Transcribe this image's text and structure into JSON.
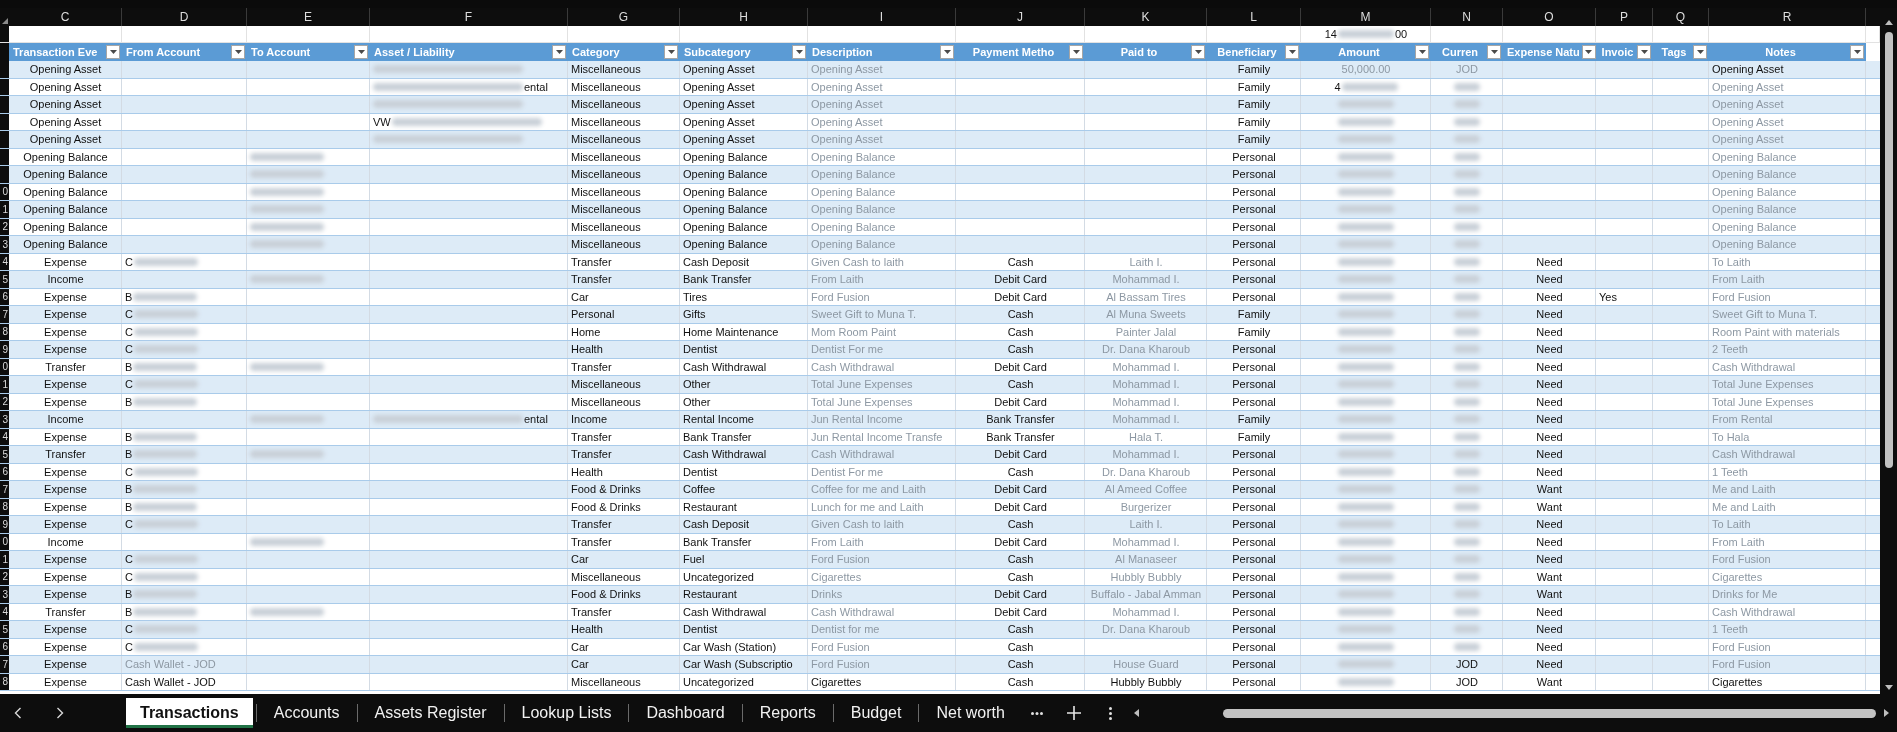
{
  "columns": [
    {
      "letter": "C",
      "header": "Transaction Eve"
    },
    {
      "letter": "D",
      "header": "From Account"
    },
    {
      "letter": "E",
      "header": "To Account"
    },
    {
      "letter": "F",
      "header": "Asset / Liability"
    },
    {
      "letter": "G",
      "header": "Category"
    },
    {
      "letter": "H",
      "header": "Subcategory"
    },
    {
      "letter": "I",
      "header": "Description"
    },
    {
      "letter": "J",
      "header": "Payment Metho"
    },
    {
      "letter": "K",
      "header": "Paid to"
    },
    {
      "letter": "L",
      "header": "Beneficiary"
    },
    {
      "letter": "M",
      "header": "Amount"
    },
    {
      "letter": "N",
      "header": "Curren"
    },
    {
      "letter": "O",
      "header": "Expense Natu"
    },
    {
      "letter": "P",
      "header": "Invoic"
    },
    {
      "letter": "Q",
      "header": "Tags"
    },
    {
      "letter": "R",
      "header": "Notes"
    }
  ],
  "summary_row": {
    "cells": [
      null,
      null,
      null,
      null,
      null,
      null,
      null,
      null,
      null,
      null,
      {
        "kind": "redacted",
        "text": "14",
        "suffix": "00"
      },
      null,
      null,
      null,
      null,
      null
    ]
  },
  "rows": [
    {
      "cells": [
        "Opening Asset",
        null,
        null,
        {
          "kind": "redacted"
        },
        "Miscellaneous",
        "Opening Asset",
        {
          "kind": "faded",
          "text": "Opening Asset"
        },
        null,
        null,
        "Family",
        {
          "kind": "faded",
          "text": "50,000.00"
        },
        {
          "kind": "faded",
          "text": "JOD"
        },
        null,
        null,
        null,
        "Opening Asset"
      ]
    },
    {
      "cells": [
        "Opening Asset",
        null,
        null,
        {
          "kind": "redacted",
          "suffix": "ental"
        },
        "Miscellaneous",
        "Opening Asset",
        {
          "kind": "faded",
          "text": "Opening Asset"
        },
        null,
        null,
        "Family",
        {
          "kind": "redacted",
          "text": "4"
        },
        {
          "kind": "redacted"
        },
        null,
        null,
        null,
        {
          "kind": "faded",
          "text": "Opening Asset"
        }
      ]
    },
    {
      "cells": [
        "Opening Asset",
        null,
        null,
        {
          "kind": "redacted"
        },
        "Miscellaneous",
        "Opening Asset",
        {
          "kind": "faded",
          "text": "Opening Asset"
        },
        null,
        null,
        "Family",
        {
          "kind": "redacted"
        },
        {
          "kind": "redacted"
        },
        null,
        null,
        null,
        {
          "kind": "faded",
          "text": "Opening Asset"
        }
      ]
    },
    {
      "cells": [
        "Opening Asset",
        null,
        null,
        {
          "kind": "redacted",
          "text": "VW"
        },
        "Miscellaneous",
        "Opening Asset",
        {
          "kind": "faded",
          "text": "Opening Asset"
        },
        null,
        null,
        "Family",
        {
          "kind": "redacted"
        },
        {
          "kind": "redacted"
        },
        null,
        null,
        null,
        {
          "kind": "faded",
          "text": "Opening Asset"
        }
      ]
    },
    {
      "cells": [
        "Opening Asset",
        null,
        null,
        {
          "kind": "redacted"
        },
        "Miscellaneous",
        "Opening Asset",
        {
          "kind": "faded",
          "text": "Opening Asset"
        },
        null,
        null,
        "Family",
        {
          "kind": "redacted"
        },
        {
          "kind": "redacted"
        },
        null,
        null,
        null,
        {
          "kind": "faded",
          "text": "Opening Asset"
        }
      ]
    },
    {
      "cells": [
        "Opening Balance",
        null,
        {
          "kind": "redacted"
        },
        null,
        "Miscellaneous",
        "Opening Balance",
        {
          "kind": "faded",
          "text": "Opening Balance"
        },
        null,
        null,
        "Personal",
        {
          "kind": "redacted"
        },
        {
          "kind": "redacted"
        },
        null,
        null,
        null,
        {
          "kind": "faded",
          "text": "Opening Balance"
        }
      ]
    },
    {
      "cells": [
        "Opening Balance",
        null,
        {
          "kind": "redacted"
        },
        null,
        "Miscellaneous",
        "Opening Balance",
        {
          "kind": "faded",
          "text": "Opening Balance"
        },
        null,
        null,
        "Personal",
        {
          "kind": "redacted"
        },
        {
          "kind": "redacted"
        },
        null,
        null,
        null,
        {
          "kind": "faded",
          "text": "Opening Balance"
        }
      ]
    },
    {
      "row_label": "0",
      "cells": [
        "Opening Balance",
        null,
        {
          "kind": "redacted"
        },
        null,
        "Miscellaneous",
        "Opening Balance",
        {
          "kind": "faded",
          "text": "Opening Balance"
        },
        null,
        null,
        "Personal",
        {
          "kind": "redacted"
        },
        {
          "kind": "redacted"
        },
        null,
        null,
        null,
        {
          "kind": "faded",
          "text": "Opening Balance"
        }
      ]
    },
    {
      "row_label": "1",
      "cells": [
        "Opening Balance",
        null,
        {
          "kind": "redacted"
        },
        null,
        "Miscellaneous",
        "Opening Balance",
        {
          "kind": "faded",
          "text": "Opening Balance"
        },
        null,
        null,
        "Personal",
        {
          "kind": "redacted"
        },
        {
          "kind": "redacted"
        },
        null,
        null,
        null,
        {
          "kind": "faded",
          "text": "Opening Balance"
        }
      ]
    },
    {
      "row_label": "2",
      "cells": [
        "Opening Balance",
        null,
        {
          "kind": "redacted"
        },
        null,
        "Miscellaneous",
        "Opening Balance",
        {
          "kind": "faded",
          "text": "Opening Balance"
        },
        null,
        null,
        "Personal",
        {
          "kind": "redacted"
        },
        {
          "kind": "redacted"
        },
        null,
        null,
        null,
        {
          "kind": "faded",
          "text": "Opening Balance"
        }
      ]
    },
    {
      "row_label": "3",
      "cells": [
        "Opening Balance",
        null,
        {
          "kind": "redacted"
        },
        null,
        "Miscellaneous",
        "Opening Balance",
        {
          "kind": "faded",
          "text": "Opening Balance"
        },
        null,
        null,
        "Personal",
        {
          "kind": "redacted"
        },
        {
          "kind": "redacted"
        },
        null,
        null,
        null,
        {
          "kind": "faded",
          "text": "Opening Balance"
        }
      ]
    },
    {
      "row_label": "4",
      "cells": [
        "Expense",
        {
          "kind": "redacted",
          "text": "C"
        },
        null,
        null,
        "Transfer",
        "Cash Deposit",
        {
          "kind": "faded",
          "text": "Given Cash to laith"
        },
        "Cash",
        {
          "kind": "faded",
          "text": "Laith I."
        },
        "Personal",
        {
          "kind": "redacted"
        },
        {
          "kind": "redacted"
        },
        "Need",
        null,
        null,
        {
          "kind": "faded",
          "text": "To Laith"
        }
      ]
    },
    {
      "row_label": "5",
      "cells": [
        "Income",
        null,
        {
          "kind": "redacted"
        },
        null,
        "Transfer",
        "Bank Transfer",
        {
          "kind": "faded",
          "text": "From Laith"
        },
        "Debit Card",
        {
          "kind": "faded",
          "text": "Mohammad I."
        },
        "Personal",
        {
          "kind": "redacted"
        },
        {
          "kind": "redacted"
        },
        "Need",
        null,
        null,
        {
          "kind": "faded",
          "text": "From Laith"
        }
      ]
    },
    {
      "row_label": "6",
      "cells": [
        "Expense",
        {
          "kind": "redacted",
          "text": "B"
        },
        null,
        null,
        "Car",
        "Tires",
        {
          "kind": "faded",
          "text": "Ford Fusion"
        },
        "Debit Card",
        {
          "kind": "faded",
          "text": "Al Bassam Tires"
        },
        "Personal",
        {
          "kind": "redacted"
        },
        {
          "kind": "redacted"
        },
        "Need",
        "Yes",
        null,
        {
          "kind": "faded",
          "text": "Ford Fusion"
        }
      ]
    },
    {
      "row_label": "7",
      "cells": [
        "Expense",
        {
          "kind": "redacted",
          "text": "C"
        },
        null,
        null,
        "Personal",
        "Gifts",
        {
          "kind": "faded",
          "text": "Sweet Gift to Muna T."
        },
        "Cash",
        {
          "kind": "faded",
          "text": "Al Muna Sweets"
        },
        "Family",
        {
          "kind": "redacted"
        },
        {
          "kind": "redacted"
        },
        "Need",
        null,
        null,
        {
          "kind": "faded",
          "text": "Sweet Gift to Muna T."
        }
      ]
    },
    {
      "row_label": "8",
      "cells": [
        "Expense",
        {
          "kind": "redacted",
          "text": "C"
        },
        null,
        null,
        "Home",
        "Home Maintenance",
        {
          "kind": "faded",
          "text": "Mom Room Paint"
        },
        "Cash",
        {
          "kind": "faded",
          "text": "Painter Jalal"
        },
        "Family",
        {
          "kind": "redacted"
        },
        {
          "kind": "redacted"
        },
        "Need",
        null,
        null,
        {
          "kind": "faded",
          "text": "Room Paint with materials"
        }
      ]
    },
    {
      "row_label": "9",
      "cells": [
        "Expense",
        {
          "kind": "redacted",
          "text": "C"
        },
        null,
        null,
        "Health",
        "Dentist",
        {
          "kind": "faded",
          "text": "Dentist For me"
        },
        "Cash",
        {
          "kind": "faded",
          "text": "Dr. Dana Kharoub"
        },
        "Personal",
        {
          "kind": "redacted"
        },
        {
          "kind": "redacted"
        },
        "Need",
        null,
        null,
        {
          "kind": "faded",
          "text": "2 Teeth"
        }
      ]
    },
    {
      "row_label": "0",
      "cells": [
        "Transfer",
        {
          "kind": "redacted",
          "text": "B"
        },
        {
          "kind": "redacted"
        },
        null,
        "Transfer",
        "Cash Withdrawal",
        {
          "kind": "faded",
          "text": "Cash Withdrawal"
        },
        "Debit Card",
        {
          "kind": "faded",
          "text": "Mohammad I."
        },
        "Personal",
        {
          "kind": "redacted"
        },
        {
          "kind": "redacted"
        },
        "Need",
        null,
        null,
        {
          "kind": "faded",
          "text": "Cash Withdrawal"
        }
      ]
    },
    {
      "row_label": "1",
      "cells": [
        "Expense",
        {
          "kind": "redacted",
          "text": "C"
        },
        null,
        null,
        "Miscellaneous",
        "Other",
        {
          "kind": "faded",
          "text": "Total June Expenses"
        },
        "Cash",
        {
          "kind": "faded",
          "text": "Mohammad I."
        },
        "Personal",
        {
          "kind": "redacted"
        },
        {
          "kind": "redacted"
        },
        "Need",
        null,
        null,
        {
          "kind": "faded",
          "text": "Total June Expenses"
        }
      ]
    },
    {
      "row_label": "2",
      "cells": [
        "Expense",
        {
          "kind": "redacted",
          "text": "B"
        },
        null,
        null,
        "Miscellaneous",
        "Other",
        {
          "kind": "faded",
          "text": "Total June Expenses"
        },
        "Debit Card",
        {
          "kind": "faded",
          "text": "Mohammad I."
        },
        "Personal",
        {
          "kind": "redacted"
        },
        {
          "kind": "redacted"
        },
        "Need",
        null,
        null,
        {
          "kind": "faded",
          "text": "Total June Expenses"
        }
      ]
    },
    {
      "row_label": "3",
      "cells": [
        "Income",
        null,
        {
          "kind": "redacted"
        },
        {
          "kind": "redacted",
          "suffix": "ental"
        },
        "Income",
        "Rental Income",
        {
          "kind": "faded",
          "text": "Jun Rental Income"
        },
        "Bank Transfer",
        {
          "kind": "faded",
          "text": "Mohammad I."
        },
        "Family",
        {
          "kind": "redacted"
        },
        {
          "kind": "redacted"
        },
        "Need",
        null,
        null,
        {
          "kind": "faded",
          "text": "From Rental"
        }
      ]
    },
    {
      "row_label": "4",
      "cells": [
        "Expense",
        {
          "kind": "redacted",
          "text": "B"
        },
        null,
        null,
        "Transfer",
        "Bank Transfer",
        {
          "kind": "faded",
          "text": "Jun Rental Income Transfe"
        },
        "Bank Transfer",
        {
          "kind": "faded",
          "text": "Hala T."
        },
        "Family",
        {
          "kind": "redacted"
        },
        {
          "kind": "redacted"
        },
        "Need",
        null,
        null,
        {
          "kind": "faded",
          "text": "To Hala"
        }
      ]
    },
    {
      "row_label": "5",
      "cells": [
        "Transfer",
        {
          "kind": "redacted",
          "text": "B"
        },
        {
          "kind": "redacted"
        },
        null,
        "Transfer",
        "Cash Withdrawal",
        {
          "kind": "faded",
          "text": "Cash Withdrawal"
        },
        "Debit Card",
        {
          "kind": "faded",
          "text": "Mohammad I."
        },
        "Personal",
        {
          "kind": "redacted"
        },
        {
          "kind": "redacted"
        },
        "Need",
        null,
        null,
        {
          "kind": "faded",
          "text": "Cash Withdrawal"
        }
      ]
    },
    {
      "row_label": "6",
      "cells": [
        "Expense",
        {
          "kind": "redacted",
          "text": "C"
        },
        null,
        null,
        "Health",
        "Dentist",
        {
          "kind": "faded",
          "text": "Dentist For me"
        },
        "Cash",
        {
          "kind": "faded",
          "text": "Dr. Dana Kharoub"
        },
        "Personal",
        {
          "kind": "redacted"
        },
        {
          "kind": "redacted"
        },
        "Need",
        null,
        null,
        {
          "kind": "faded",
          "text": "1 Teeth"
        }
      ]
    },
    {
      "row_label": "7",
      "cells": [
        "Expense",
        {
          "kind": "redacted",
          "text": "B"
        },
        null,
        null,
        "Food & Drinks",
        "Coffee",
        {
          "kind": "faded",
          "text": "Coffee for me and Laith"
        },
        "Debit Card",
        {
          "kind": "faded",
          "text": "Al Ameed Coffee"
        },
        "Personal",
        {
          "kind": "redacted"
        },
        {
          "kind": "redacted"
        },
        "Want",
        null,
        null,
        {
          "kind": "faded",
          "text": "Me and Laith"
        }
      ]
    },
    {
      "row_label": "8",
      "cells": [
        "Expense",
        {
          "kind": "redacted",
          "text": "B"
        },
        null,
        null,
        "Food & Drinks",
        "Restaurant",
        {
          "kind": "faded",
          "text": "Lunch for me and Laith"
        },
        "Debit Card",
        {
          "kind": "faded",
          "text": "Burgerizer"
        },
        "Personal",
        {
          "kind": "redacted"
        },
        {
          "kind": "redacted"
        },
        "Want",
        null,
        null,
        {
          "kind": "faded",
          "text": "Me and Laith"
        }
      ]
    },
    {
      "row_label": "9",
      "cells": [
        "Expense",
        {
          "kind": "redacted",
          "text": "C"
        },
        null,
        null,
        "Transfer",
        "Cash Deposit",
        {
          "kind": "faded",
          "text": "Given Cash to laith"
        },
        "Cash",
        {
          "kind": "faded",
          "text": "Laith I."
        },
        "Personal",
        {
          "kind": "redacted"
        },
        {
          "kind": "redacted"
        },
        "Need",
        null,
        null,
        {
          "kind": "faded",
          "text": "To Laith"
        }
      ]
    },
    {
      "row_label": "0",
      "cells": [
        "Income",
        null,
        {
          "kind": "redacted"
        },
        null,
        "Transfer",
        "Bank Transfer",
        {
          "kind": "faded",
          "text": "From Laith"
        },
        "Debit Card",
        {
          "kind": "faded",
          "text": "Mohammad I."
        },
        "Personal",
        {
          "kind": "redacted"
        },
        {
          "kind": "redacted"
        },
        "Need",
        null,
        null,
        {
          "kind": "faded",
          "text": "From Laith"
        }
      ]
    },
    {
      "row_label": "1",
      "cells": [
        "Expense",
        {
          "kind": "redacted",
          "text": "C"
        },
        null,
        null,
        "Car",
        "Fuel",
        {
          "kind": "faded",
          "text": "Ford Fusion"
        },
        "Cash",
        {
          "kind": "faded",
          "text": "Al Manaseer"
        },
        "Personal",
        {
          "kind": "redacted"
        },
        {
          "kind": "redacted"
        },
        "Need",
        null,
        null,
        {
          "kind": "faded",
          "text": "Ford Fusion"
        }
      ]
    },
    {
      "row_label": "2",
      "cells": [
        "Expense",
        {
          "kind": "redacted",
          "text": "C"
        },
        null,
        null,
        "Miscellaneous",
        "Uncategorized",
        {
          "kind": "faded",
          "text": "Cigarettes"
        },
        "Cash",
        {
          "kind": "faded",
          "text": "Hubbly Bubbly"
        },
        "Personal",
        {
          "kind": "redacted"
        },
        {
          "kind": "redacted"
        },
        "Want",
        null,
        null,
        {
          "kind": "faded",
          "text": "Cigarettes"
        }
      ]
    },
    {
      "row_label": "3",
      "cells": [
        "Expense",
        {
          "kind": "redacted",
          "text": "B"
        },
        null,
        null,
        "Food & Drinks",
        "Restaurant",
        {
          "kind": "faded",
          "text": "Drinks"
        },
        "Debit Card",
        {
          "kind": "faded",
          "text": "Buffalo - Jabal Amman"
        },
        "Personal",
        {
          "kind": "redacted"
        },
        {
          "kind": "redacted"
        },
        "Want",
        null,
        null,
        {
          "kind": "faded",
          "text": "Drinks for Me"
        }
      ]
    },
    {
      "row_label": "4",
      "cells": [
        "Transfer",
        {
          "kind": "redacted",
          "text": "B"
        },
        {
          "kind": "redacted"
        },
        null,
        "Transfer",
        "Cash Withdrawal",
        {
          "kind": "faded",
          "text": "Cash Withdrawal"
        },
        "Debit Card",
        {
          "kind": "faded",
          "text": "Mohammad I."
        },
        "Personal",
        {
          "kind": "redacted"
        },
        {
          "kind": "redacted"
        },
        "Need",
        null,
        null,
        {
          "kind": "faded",
          "text": "Cash Withdrawal"
        }
      ]
    },
    {
      "row_label": "5",
      "cells": [
        "Expense",
        {
          "kind": "redacted",
          "text": "C"
        },
        null,
        null,
        "Health",
        "Dentist",
        {
          "kind": "faded",
          "text": "Dentist for me"
        },
        "Cash",
        {
          "kind": "faded",
          "text": "Dr. Dana Kharoub"
        },
        "Personal",
        {
          "kind": "redacted"
        },
        {
          "kind": "redacted"
        },
        "Need",
        null,
        null,
        {
          "kind": "faded",
          "text": "1 Teeth"
        }
      ]
    },
    {
      "row_label": "6",
      "cells": [
        "Expense",
        {
          "kind": "redacted",
          "text": "C"
        },
        null,
        null,
        "Car",
        "Car Wash (Station)",
        {
          "kind": "faded",
          "text": "Ford Fusion"
        },
        "Cash",
        null,
        "Personal",
        {
          "kind": "redacted"
        },
        {
          "kind": "redacted"
        },
        "Need",
        null,
        null,
        {
          "kind": "faded",
          "text": "Ford Fusion"
        }
      ]
    },
    {
      "row_label": "7",
      "cells": [
        "Expense",
        {
          "kind": "faded",
          "text": "Cash Wallet - JOD"
        },
        null,
        null,
        "Car",
        "Car Wash (Subscriptio",
        {
          "kind": "faded",
          "text": "Ford Fusion"
        },
        "Cash",
        {
          "kind": "faded",
          "text": "House Guard"
        },
        "Personal",
        {
          "kind": "redacted"
        },
        "JOD",
        "Need",
        null,
        null,
        {
          "kind": "faded",
          "text": "Ford Fusion"
        }
      ]
    },
    {
      "row_label": "8",
      "cells": [
        "Expense",
        "Cash Wallet - JOD",
        null,
        null,
        "Miscellaneous",
        "Uncategorized",
        "Cigarettes",
        "Cash",
        "Hubbly Bubbly",
        "Personal",
        {
          "kind": "redacted"
        },
        "JOD",
        "Want",
        null,
        null,
        "Cigarettes"
      ]
    }
  ],
  "sheet_tabs": [
    {
      "label": "Transactions",
      "selected": true
    },
    {
      "label": "Accounts",
      "selected": false
    },
    {
      "label": "Assets Register",
      "selected": false
    },
    {
      "label": "Lookup Lists",
      "selected": false
    },
    {
      "label": "Dashboard",
      "selected": false
    },
    {
      "label": "Reports",
      "selected": false
    },
    {
      "label": "Budget",
      "selected": false
    },
    {
      "label": "Net worth",
      "selected": false
    }
  ]
}
